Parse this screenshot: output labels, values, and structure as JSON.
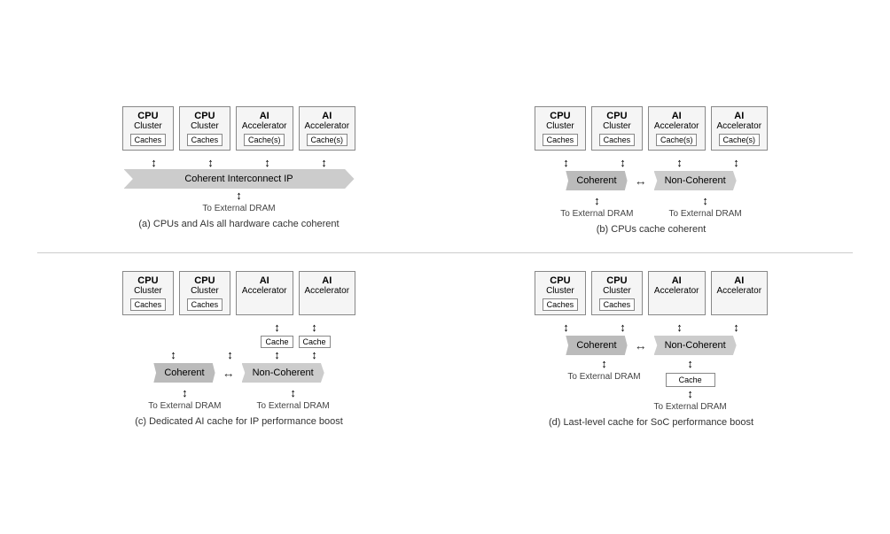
{
  "diagrams": {
    "a": {
      "caption": "(a) CPUs and AIs all hardware cache coherent",
      "nodes": [
        {
          "title": "CPU",
          "subtitle": "Cluster",
          "cache": "Caches"
        },
        {
          "title": "CPU",
          "subtitle": "Cluster",
          "cache": "Caches"
        },
        {
          "title": "AI",
          "subtitle": "Accelerator",
          "cache": "Cache(s)"
        },
        {
          "title": "AI",
          "subtitle": "Accelerator",
          "cache": "Cache(s)"
        }
      ],
      "interconnect": "Coherent Interconnect IP",
      "dram_label": "To External DRAM"
    },
    "b": {
      "caption": "(b) CPUs cache coherent",
      "nodes": [
        {
          "title": "CPU",
          "subtitle": "Cluster",
          "cache": "Caches"
        },
        {
          "title": "CPU",
          "subtitle": "Cluster",
          "cache": "Caches"
        },
        {
          "title": "AI",
          "subtitle": "Accelerator",
          "cache": "Cache(s)"
        },
        {
          "title": "AI",
          "subtitle": "Accelerator",
          "cache": "Cache(s)"
        }
      ],
      "coherent": "Coherent",
      "noncoherent": "Non-Coherent",
      "dram_left": "To External DRAM",
      "dram_right": "To External DRAM"
    },
    "c": {
      "caption": "(c) Dedicated AI cache for IP performance boost",
      "nodes": [
        {
          "title": "CPU",
          "subtitle": "Cluster",
          "cache": "Caches"
        },
        {
          "title": "CPU",
          "subtitle": "Cluster",
          "cache": "Caches"
        },
        {
          "title": "AI",
          "subtitle": "Accelerator",
          "cache": null
        },
        {
          "title": "AI",
          "subtitle": "Accelerator",
          "cache": null
        }
      ],
      "ai_cache": "Cache",
      "coherent": "Coherent",
      "noncoherent": "Non-Coherent",
      "dram_left": "To External DRAM",
      "dram_right": "To External DRAM"
    },
    "d": {
      "caption": "(d) Last-level cache for SoC performance boost",
      "nodes": [
        {
          "title": "CPU",
          "subtitle": "Cluster",
          "cache": "Caches"
        },
        {
          "title": "CPU",
          "subtitle": "Cluster",
          "cache": "Caches"
        },
        {
          "title": "AI",
          "subtitle": "Accelerator",
          "cache": null
        },
        {
          "title": "AI",
          "subtitle": "Accelerator",
          "cache": null
        }
      ],
      "coherent": "Coherent",
      "noncoherent": "Non-Coherent",
      "llc": "Cache",
      "dram_left": "To External DRAM",
      "dram_right": "To External DRAM"
    }
  }
}
